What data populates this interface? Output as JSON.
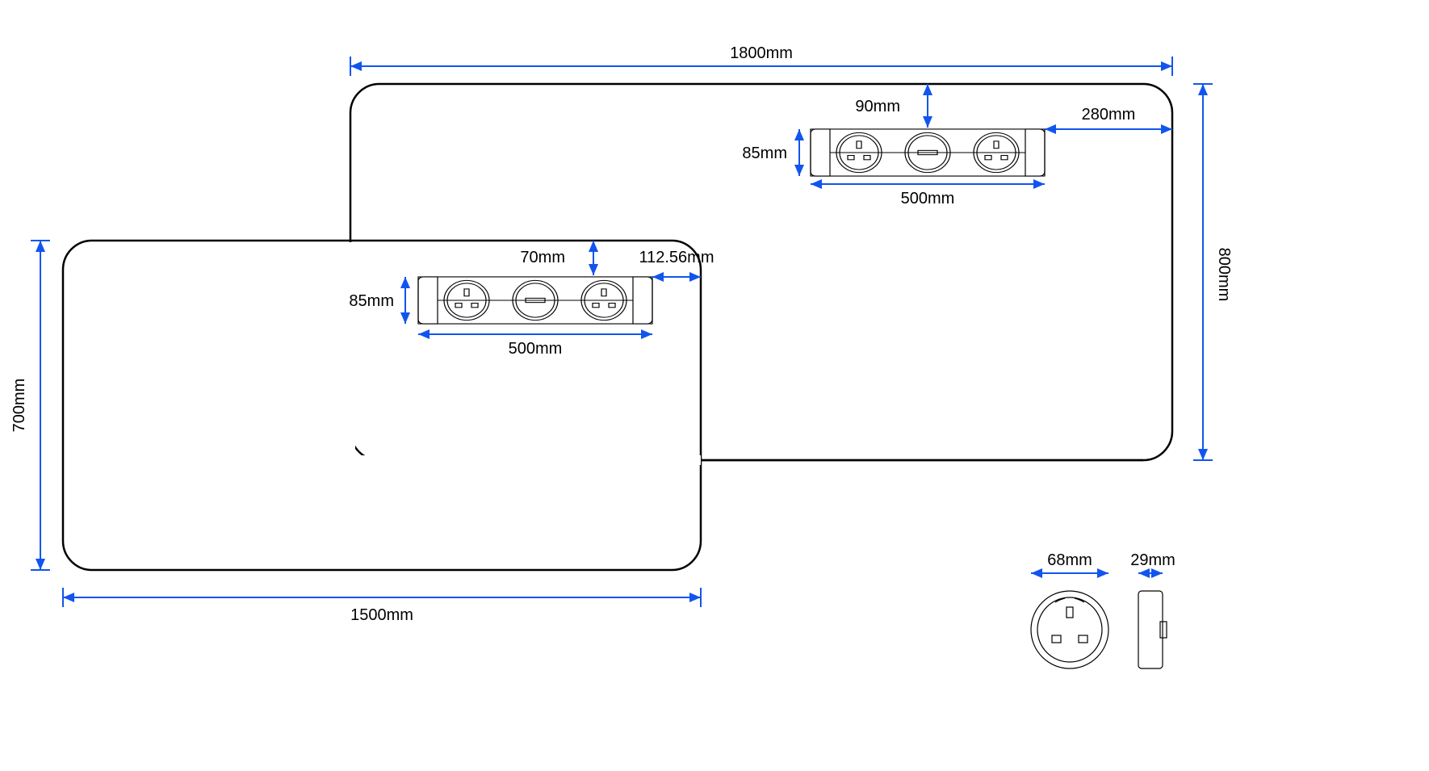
{
  "desk_large": {
    "width_label": "1800mm",
    "height_label": "800mm",
    "outlet": {
      "width_label": "500mm",
      "height_label": "85mm",
      "top_offset_label": "90mm",
      "right_offset_label": "280mm"
    }
  },
  "desk_small": {
    "width_label": "1500mm",
    "height_label": "700mm",
    "outlet": {
      "width_label": "500mm",
      "height_label": "85mm",
      "top_offset_label": "70mm",
      "right_offset_label": "112.56mm"
    }
  },
  "plug_detail": {
    "diameter_label": "68mm",
    "depth_label": "29mm"
  },
  "unit": "mm"
}
